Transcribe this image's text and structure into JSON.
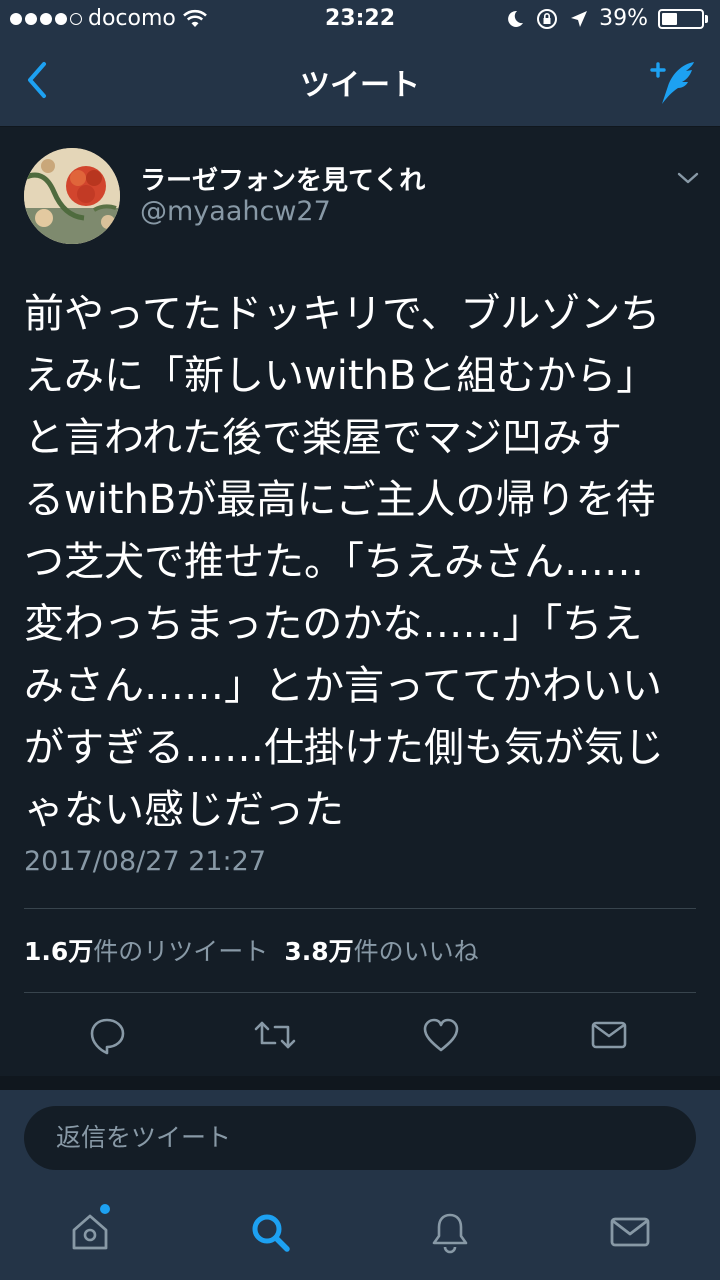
{
  "status_bar": {
    "carrier": "docomo",
    "time": "23:22",
    "battery": "39%",
    "battery_level": 0.39
  },
  "nav": {
    "title": "ツイート",
    "icons": {
      "back": "chevron-left-icon",
      "compose": "compose-tweet-icon"
    }
  },
  "tweet": {
    "display_name": "ラーゼフォンを見てくれ",
    "handle": "@myaahcw27",
    "text": "前やってたドッキリで、ブルゾンち\nえみに「新しいwithBと組むから」\nと言われた後で楽屋でマジ凹みす\nるwithBが最高にご主人の帰りを待\nつ芝犬で推せた。「ちえみさん……\n変わっちまったのかな……」「ちえ\nみさん……」とか言っててかわいい\nがすぎる……仕掛けた側も気が気じ\nゃない感じだった",
    "timestamp": "2017/08/27 21:27",
    "retweets": {
      "count": "1.6万",
      "label": "件のリツイート"
    },
    "likes": {
      "count": "3.8万",
      "label": "件のいいね"
    },
    "actions": [
      "reply-icon",
      "retweet-icon",
      "like-icon",
      "direct-message-icon"
    ]
  },
  "reply": {
    "placeholder": "返信をツイート"
  },
  "tabbar": {
    "tabs": [
      "home-icon",
      "search-icon",
      "notifications-icon",
      "messages-icon"
    ],
    "active": "search-icon"
  },
  "colors": {
    "background": "#141d26",
    "bar": "#243447",
    "accent": "#1da1f2",
    "secondary_text": "#8899a6",
    "divider": "#38444d"
  }
}
